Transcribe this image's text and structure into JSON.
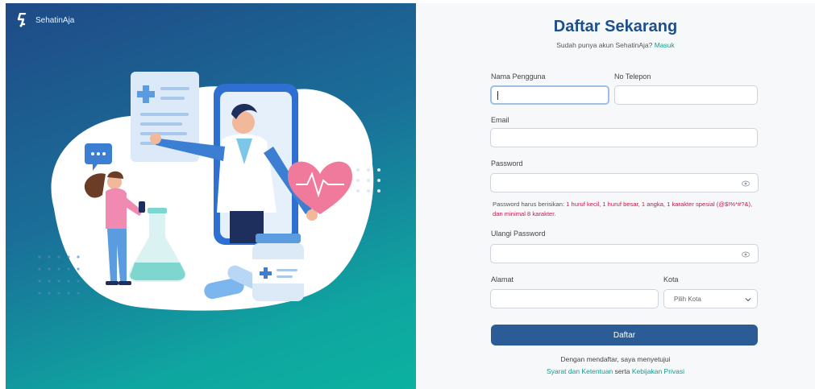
{
  "brand": {
    "name": "SehatinAja",
    "logo_icon": "s-logo-icon"
  },
  "colors": {
    "primary": "#2b5c96",
    "title": "#1d4f8c",
    "accent_link": "#139c8c",
    "warning": "#c9184a",
    "left_gradient_start": "#1f4a86",
    "left_gradient_end": "#0bb2a0"
  },
  "illustration": {
    "icon": "doctor-telehealth-illustration"
  },
  "form": {
    "title": "Daftar Sekarang",
    "subtitle_prefix": "Sudah punya akun SehatinAja?",
    "login_link": "Masuk",
    "username": {
      "label": "Nama Pengguna",
      "value": "",
      "placeholder": ""
    },
    "phone": {
      "label": "No Telepon",
      "value": "",
      "placeholder": ""
    },
    "email": {
      "label": "Email",
      "value": "",
      "placeholder": ""
    },
    "password": {
      "label": "Password",
      "value": "",
      "placeholder": "",
      "toggle_icon": "eye-icon"
    },
    "password_hint": {
      "prefix": "Password harus berisikan:",
      "requirements": "1 huruf kecil, 1 huruf besar, 1 angka, 1 karakter spesial (@$!%*#?&), dan minimal 8 karakter."
    },
    "confirm_password": {
      "label": "Ulangi Password",
      "value": "",
      "placeholder": "",
      "toggle_icon": "eye-icon"
    },
    "address": {
      "label": "Alamat",
      "value": "",
      "placeholder": ""
    },
    "city": {
      "label": "Kota",
      "selected": "Pilih Kota",
      "chevron_icon": "chevron-down-icon"
    },
    "submit_label": "Daftar",
    "terms_line1": "Dengan mendaftar, saya menyetujui",
    "terms_link": "Syarat dan Ketentuan",
    "terms_conj": "serta",
    "privacy_link": "Kebijakan Privasi"
  }
}
